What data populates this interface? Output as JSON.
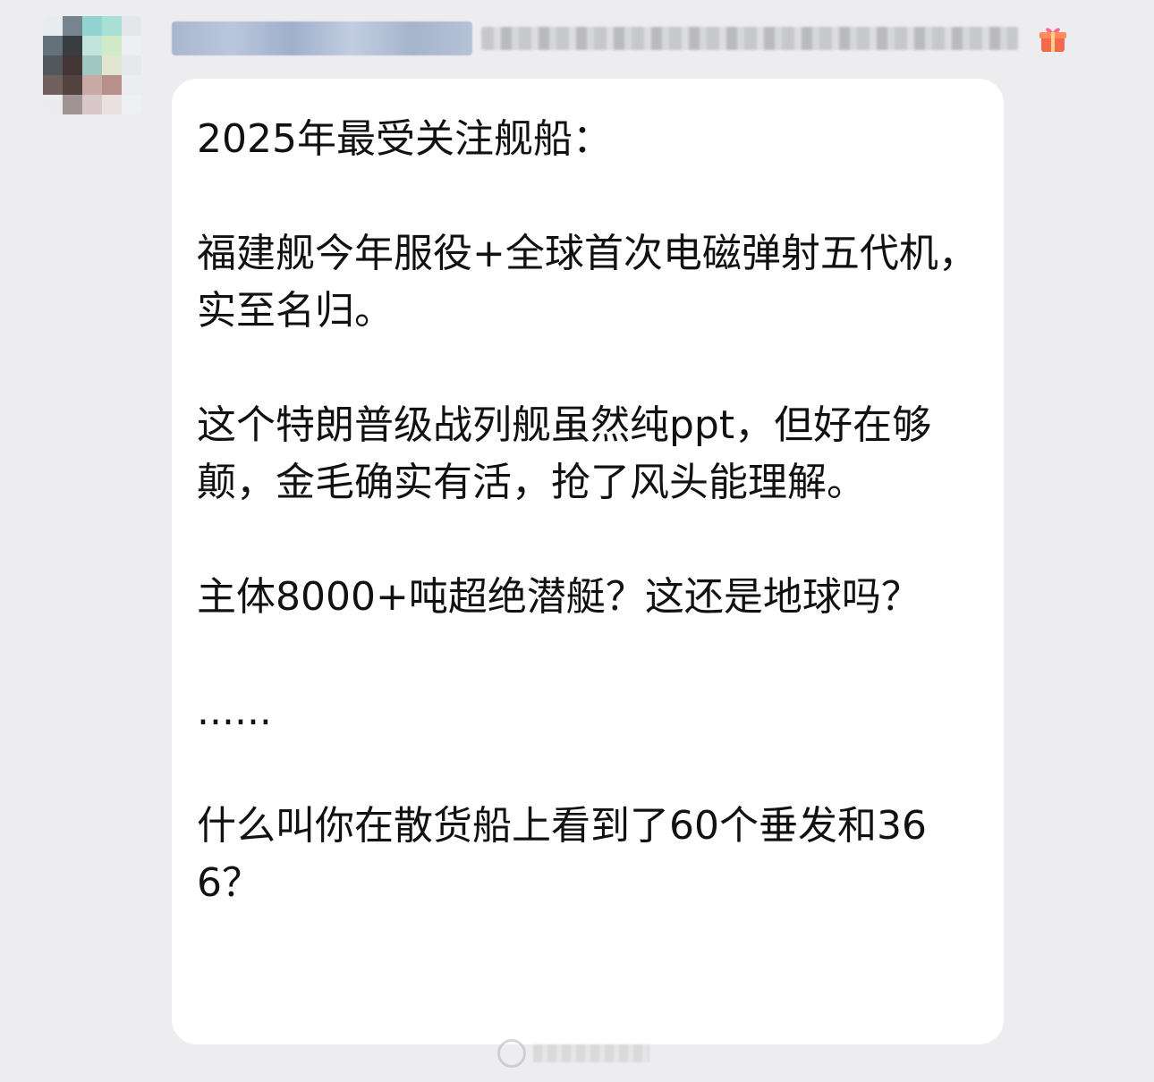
{
  "sender": {
    "name": "",
    "meta": ""
  },
  "avatar": {
    "colors": [
      "#e9ecef",
      "#6f7f8a",
      "#8fd3cf",
      "#a6dfd4",
      "#e3e7ea",
      "#5b6b74",
      "#2f3439",
      "#bfe4dc",
      "#cfe9c4",
      "#eef1f3",
      "#4a4f56",
      "#3b2d2a",
      "#9ac7bf",
      "#e2e6cf",
      "#e6e9ec",
      "#6a5a57",
      "#4b3a37",
      "#c9a7a1",
      "#b58a86",
      "#eceef0",
      "#ececee",
      "#9b8f8f",
      "#d8c7c7",
      "#e9e0e0",
      "#f0f1f3"
    ]
  },
  "message": {
    "paragraphs": [
      "2025年最受关注舰船：",
      "福建舰今年服役+全球首次电磁弹射五代机，实至名归。",
      "这个特朗普级战列舰虽然纯ppt，但好在够颠，金毛确实有活，抢了风头能理解。",
      "主体8000+吨超绝潜艇？这还是地球吗？",
      "......",
      "什么叫你在散货船上看到了60个垂发和366？"
    ]
  },
  "watermark": {
    "text": ""
  },
  "colors": {
    "background": "#ededf0",
    "bubble": "#ffffff",
    "text": "#111111"
  }
}
